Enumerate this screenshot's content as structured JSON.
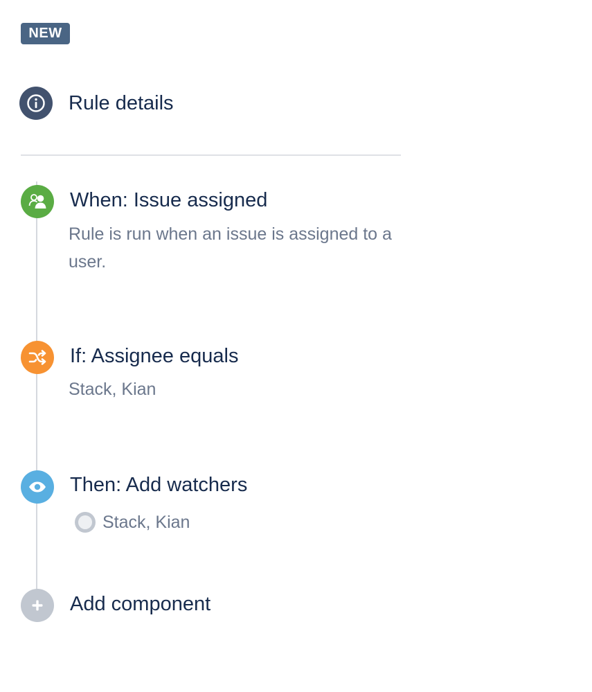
{
  "badge": {
    "label": "NEW",
    "color": "#4a6584"
  },
  "rule_details": {
    "label": "Rule details",
    "icon": "info-icon",
    "color": "#42526e"
  },
  "components": [
    {
      "title": "When: Issue assigned",
      "description": "Rule is run when an issue is assigned to a user.",
      "icon": "user-assign-icon",
      "color": "#5aac44"
    },
    {
      "title": "If: Assignee equals",
      "description": "Stack, Kian",
      "icon": "shuffle-icon",
      "color": "#f79232"
    },
    {
      "title": "Then: Add watchers",
      "watcher": "Stack, Kian",
      "icon": "eye-icon",
      "color": "#59afe1"
    }
  ],
  "add_component": {
    "label": "Add component",
    "icon": "plus-icon",
    "color": "#c1c7d0"
  }
}
